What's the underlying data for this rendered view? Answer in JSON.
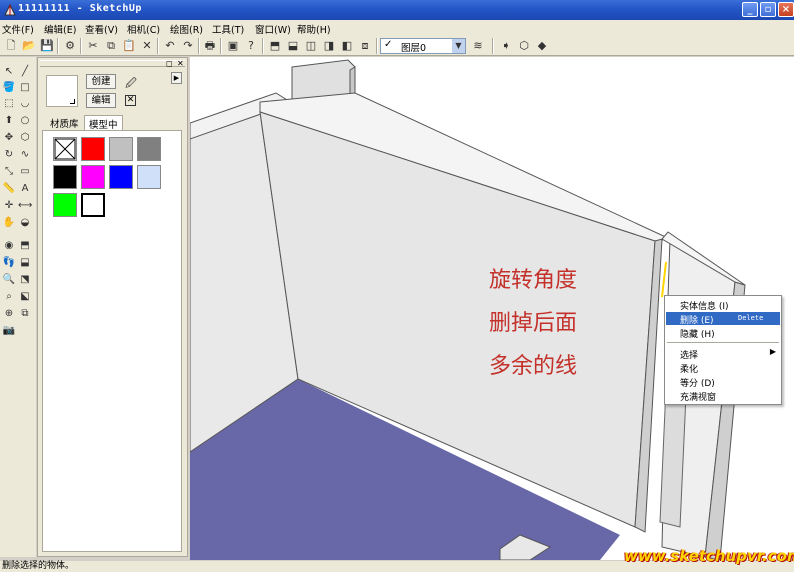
{
  "window": {
    "title": "11111111 - SketchUp"
  },
  "menu": [
    "文件(F)",
    "编辑(E)",
    "查看(V)",
    "相机(C)",
    "绘图(R)",
    "工具(T)",
    "窗口(W)",
    "帮助(H)"
  ],
  "toolbar": {
    "icons": [
      "new-icon",
      "open-icon",
      "save-icon",
      "make-component-icon",
      "cut-icon",
      "copy-icon",
      "paste-icon",
      "erase-icon",
      "undo-icon",
      "redo-icon",
      "print-icon",
      "model-info-icon",
      "help-icon",
      "iso-view-icon",
      "top-view-icon",
      "front-view-icon",
      "right-view-icon",
      "back-view-icon",
      "left-view-icon",
      "layers-icon",
      "section-plane-icon",
      "display-section-icon",
      "section-cuts-icon"
    ],
    "layer_value": "图层0"
  },
  "material_panel": {
    "create_label": "创建",
    "edit_label": "编辑",
    "tabs": [
      "材质库",
      "模型中"
    ],
    "active_tab": "模型中",
    "swatches": [
      "none",
      "#ff0000",
      "#c0c0c0",
      "#808080",
      "#000000",
      "#ff00ff",
      "#0000ff",
      "#cfe0f8",
      "#00ff00",
      "#ffffff"
    ]
  },
  "annotation": {
    "line1": "旋转角度",
    "line2": "删掉后面",
    "line3": "多余的线"
  },
  "context_menu": {
    "items": [
      {
        "label": "实体信息 (I)",
        "shortcut": ""
      },
      {
        "label": "删除 (E)",
        "shortcut": "Delete",
        "highlighted": true
      },
      {
        "label": "隐藏 (H)",
        "shortcut": ""
      },
      {
        "label": "选择",
        "submenu": true
      },
      {
        "label": "柔化",
        "shortcut": ""
      },
      {
        "label": "等分 (D)",
        "shortcut": ""
      },
      {
        "label": "充满视窗",
        "shortcut": ""
      }
    ]
  },
  "status": {
    "text": "删除选择的物体。"
  },
  "watermark": "www.sketchupvr.com",
  "colors": {
    "floor": "#6868a8",
    "wall_face": "#e6e6e6",
    "wall_side": "#c8c8c8",
    "highlight": "#316ac5",
    "annotation": "#c4302a"
  }
}
